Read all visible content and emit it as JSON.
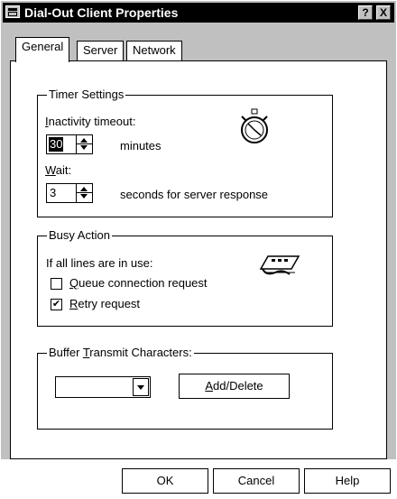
{
  "window": {
    "title": "Dial-Out Client Properties",
    "help_button": "?",
    "close_button": "X"
  },
  "tabs": [
    {
      "label": "General",
      "active": true
    },
    {
      "label": "Server",
      "active": false
    },
    {
      "label": "Network",
      "active": false
    }
  ],
  "timer": {
    "legend": "Timer Settings",
    "inactivity_label": "Inactivity timeout:",
    "inactivity_value": "30",
    "inactivity_unit": "minutes",
    "wait_label": "Wait:",
    "wait_value": "3",
    "wait_unit": "seconds for server response",
    "icon": "stopwatch-icon"
  },
  "busy": {
    "legend": "Busy Action",
    "intro": "If all lines are in use:",
    "queue_label": "Queue connection request",
    "queue_checked": false,
    "retry_label": "Retry request",
    "retry_checked": true,
    "icon": "modem-icon"
  },
  "buffer": {
    "legend": "Buffer Transmit Characters:",
    "selected_value": "",
    "add_delete_label": "Add/Delete"
  },
  "buttons": {
    "ok": "OK",
    "cancel": "Cancel",
    "help": "Help"
  }
}
